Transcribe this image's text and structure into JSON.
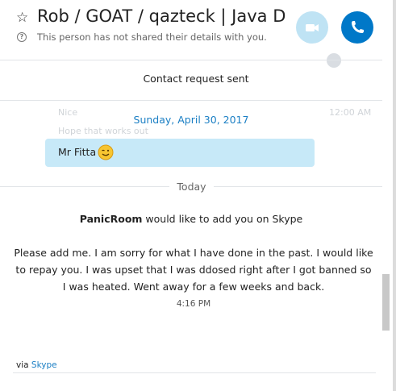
{
  "header": {
    "star_icon": "star-outline-icon",
    "title": "Rob / GOAT / qazteck | Java D...",
    "subtitle": "This person has not shared their details with you.",
    "video_icon": "video-camera-icon",
    "call_icon": "phone-icon"
  },
  "notice": "Contact request sent",
  "history": {
    "ghost_nice": "Nice",
    "ghost_time": "12:00 AM",
    "ghost_line": "Hope that works out",
    "date_label": "Sunday, April 30, 2017",
    "bubble_text": "Mr Fitta",
    "emoji_icon": "wink-smiley-icon"
  },
  "today_label": "Today",
  "request": {
    "name": "PanicRoom",
    "text": " would like to add you on Skype"
  },
  "message": {
    "body": "Please add me. I am sorry for what I have done in the past. I would like to repay you. I was upset that I was ddosed right after I got banned so I was heated. Went away for a few weeks and back.",
    "time": "4:16 PM"
  },
  "footer": {
    "via_prefix": "via ",
    "via_link": "Skype"
  },
  "colors": {
    "accent": "#0078c8",
    "bubble": "#c7e9f8",
    "date_blue": "#1b7fc4"
  }
}
